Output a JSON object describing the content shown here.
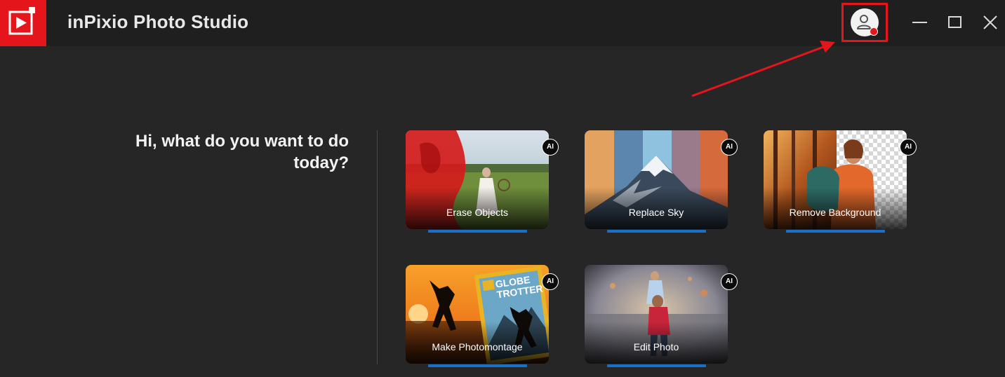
{
  "window": {
    "title": "inPixio Photo Studio",
    "accent_color": "#e4161c",
    "account_icon": "user-icon",
    "controls": [
      "minimize-icon",
      "maximize-icon",
      "close-icon"
    ]
  },
  "main": {
    "greeting": "Hi, what do you want to do today?",
    "cards": [
      {
        "label": "Erase Objects",
        "badge": "AI"
      },
      {
        "label": "Replace Sky",
        "badge": "AI"
      },
      {
        "label": "Remove Background",
        "badge": "AI"
      },
      {
        "label": "Make Photomontage",
        "badge": "AI"
      },
      {
        "label": "Edit Photo",
        "badge": "AI"
      }
    ]
  },
  "thumbnails": {
    "magazine_title_1": "GLOBE",
    "magazine_title_2": "TROTTER"
  },
  "highlight_color": "#1a6fc9"
}
